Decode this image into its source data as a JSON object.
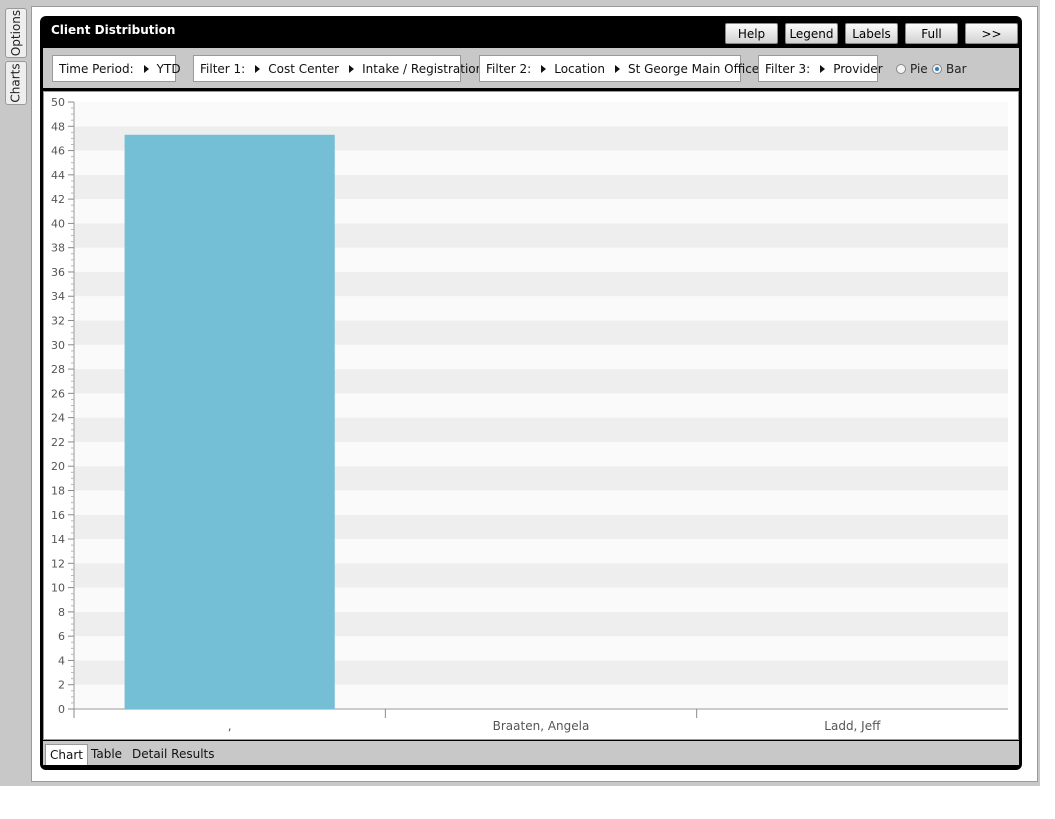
{
  "side_tabs": [
    "Options",
    "Charts"
  ],
  "panel": {
    "title": "Client Distribution",
    "buttons": [
      "Help",
      "Legend",
      "Labels",
      "Full",
      ">>"
    ]
  },
  "filters": {
    "time_period": {
      "label": "Time Period:",
      "value": "YTD"
    },
    "filter1": {
      "label": "Filter 1:",
      "path": [
        "Cost Center",
        "Intake / Registration"
      ]
    },
    "filter2": {
      "label": "Filter 2:",
      "path": [
        "Location",
        "St George Main Office"
      ]
    },
    "filter3": {
      "label": "Filter 3:",
      "path": [
        "Provider"
      ]
    },
    "chart_type_options": [
      {
        "label": "Pie",
        "selected": false
      },
      {
        "label": "Bar",
        "selected": true
      }
    ]
  },
  "bottom_tabs": [
    {
      "label": "Chart",
      "active": true
    },
    {
      "label": "Table",
      "active": false
    },
    {
      "label": "Detail Results",
      "active": false
    }
  ],
  "chart_data": {
    "type": "bar",
    "categories": [
      ",",
      "Braaten, Angela",
      "Ladd, Jeff"
    ],
    "values": [
      47.3,
      0,
      0
    ],
    "ylim": [
      0,
      50
    ],
    "y_ticks": [
      0,
      2,
      4,
      6,
      8,
      10,
      12,
      14,
      16,
      18,
      20,
      22,
      24,
      26,
      28,
      30,
      32,
      34,
      36,
      38,
      40,
      42,
      44,
      46,
      48,
      50
    ],
    "bar_color": "#74bfd6",
    "band_color": "#eeeeee",
    "grid": false
  }
}
